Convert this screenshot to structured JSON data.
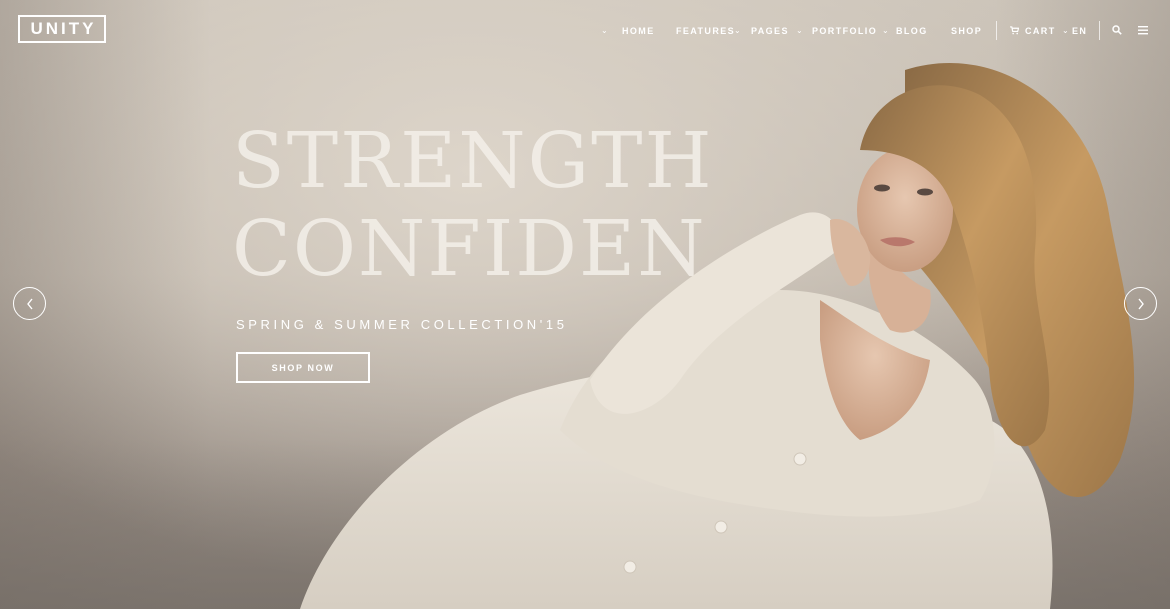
{
  "header": {
    "logo": "UNITY",
    "nav": [
      {
        "label": "HOME",
        "has_dropdown": true
      },
      {
        "label": "FEATURES",
        "has_dropdown": true
      },
      {
        "label": "PAGES",
        "has_dropdown": true
      },
      {
        "label": "PORTFOLIO",
        "has_dropdown": true
      },
      {
        "label": "BLOG",
        "has_dropdown": false
      },
      {
        "label": "SHOP",
        "has_dropdown": false
      }
    ],
    "cart_label": "CART",
    "language": "EN",
    "icons": [
      "cart-icon",
      "search-icon",
      "menu-icon",
      "chevron-down-icon",
      "chevron-left-icon",
      "chevron-right-icon"
    ]
  },
  "slide": {
    "headline_line1": "STRENGTH",
    "headline_line2": "CONFIDEN",
    "subtitle": "SPRING & SUMMER COLLECTION'15",
    "cta_label": "SHOP NOW"
  },
  "colors": {
    "text": "#ffffff",
    "headline": "#f4f0ea",
    "background": "#cbc3b8",
    "sweater": "#e8e1d6",
    "hair": "#b38a55",
    "skin": "#d9b79e"
  }
}
